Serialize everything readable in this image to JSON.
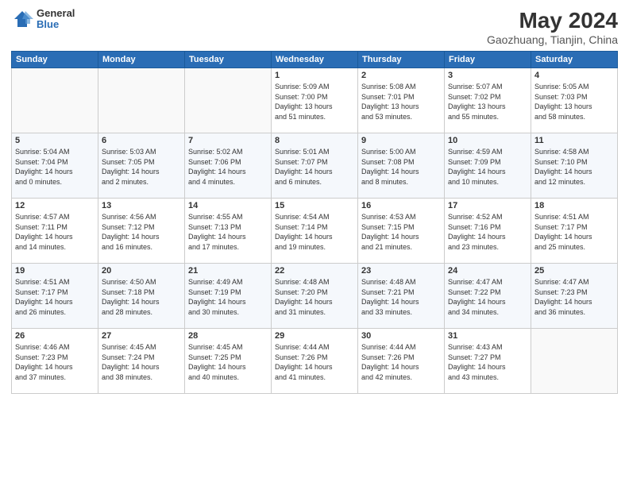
{
  "logo": {
    "general": "General",
    "blue": "Blue"
  },
  "header": {
    "title": "May 2024",
    "subtitle": "Gaozhuang, Tianjin, China"
  },
  "weekdays": [
    "Sunday",
    "Monday",
    "Tuesday",
    "Wednesday",
    "Thursday",
    "Friday",
    "Saturday"
  ],
  "weeks": [
    [
      {
        "day": "",
        "info": ""
      },
      {
        "day": "",
        "info": ""
      },
      {
        "day": "",
        "info": ""
      },
      {
        "day": "1",
        "info": "Sunrise: 5:09 AM\nSunset: 7:00 PM\nDaylight: 13 hours\nand 51 minutes."
      },
      {
        "day": "2",
        "info": "Sunrise: 5:08 AM\nSunset: 7:01 PM\nDaylight: 13 hours\nand 53 minutes."
      },
      {
        "day": "3",
        "info": "Sunrise: 5:07 AM\nSunset: 7:02 PM\nDaylight: 13 hours\nand 55 minutes."
      },
      {
        "day": "4",
        "info": "Sunrise: 5:05 AM\nSunset: 7:03 PM\nDaylight: 13 hours\nand 58 minutes."
      }
    ],
    [
      {
        "day": "5",
        "info": "Sunrise: 5:04 AM\nSunset: 7:04 PM\nDaylight: 14 hours\nand 0 minutes."
      },
      {
        "day": "6",
        "info": "Sunrise: 5:03 AM\nSunset: 7:05 PM\nDaylight: 14 hours\nand 2 minutes."
      },
      {
        "day": "7",
        "info": "Sunrise: 5:02 AM\nSunset: 7:06 PM\nDaylight: 14 hours\nand 4 minutes."
      },
      {
        "day": "8",
        "info": "Sunrise: 5:01 AM\nSunset: 7:07 PM\nDaylight: 14 hours\nand 6 minutes."
      },
      {
        "day": "9",
        "info": "Sunrise: 5:00 AM\nSunset: 7:08 PM\nDaylight: 14 hours\nand 8 minutes."
      },
      {
        "day": "10",
        "info": "Sunrise: 4:59 AM\nSunset: 7:09 PM\nDaylight: 14 hours\nand 10 minutes."
      },
      {
        "day": "11",
        "info": "Sunrise: 4:58 AM\nSunset: 7:10 PM\nDaylight: 14 hours\nand 12 minutes."
      }
    ],
    [
      {
        "day": "12",
        "info": "Sunrise: 4:57 AM\nSunset: 7:11 PM\nDaylight: 14 hours\nand 14 minutes."
      },
      {
        "day": "13",
        "info": "Sunrise: 4:56 AM\nSunset: 7:12 PM\nDaylight: 14 hours\nand 16 minutes."
      },
      {
        "day": "14",
        "info": "Sunrise: 4:55 AM\nSunset: 7:13 PM\nDaylight: 14 hours\nand 17 minutes."
      },
      {
        "day": "15",
        "info": "Sunrise: 4:54 AM\nSunset: 7:14 PM\nDaylight: 14 hours\nand 19 minutes."
      },
      {
        "day": "16",
        "info": "Sunrise: 4:53 AM\nSunset: 7:15 PM\nDaylight: 14 hours\nand 21 minutes."
      },
      {
        "day": "17",
        "info": "Sunrise: 4:52 AM\nSunset: 7:16 PM\nDaylight: 14 hours\nand 23 minutes."
      },
      {
        "day": "18",
        "info": "Sunrise: 4:51 AM\nSunset: 7:17 PM\nDaylight: 14 hours\nand 25 minutes."
      }
    ],
    [
      {
        "day": "19",
        "info": "Sunrise: 4:51 AM\nSunset: 7:17 PM\nDaylight: 14 hours\nand 26 minutes."
      },
      {
        "day": "20",
        "info": "Sunrise: 4:50 AM\nSunset: 7:18 PM\nDaylight: 14 hours\nand 28 minutes."
      },
      {
        "day": "21",
        "info": "Sunrise: 4:49 AM\nSunset: 7:19 PM\nDaylight: 14 hours\nand 30 minutes."
      },
      {
        "day": "22",
        "info": "Sunrise: 4:48 AM\nSunset: 7:20 PM\nDaylight: 14 hours\nand 31 minutes."
      },
      {
        "day": "23",
        "info": "Sunrise: 4:48 AM\nSunset: 7:21 PM\nDaylight: 14 hours\nand 33 minutes."
      },
      {
        "day": "24",
        "info": "Sunrise: 4:47 AM\nSunset: 7:22 PM\nDaylight: 14 hours\nand 34 minutes."
      },
      {
        "day": "25",
        "info": "Sunrise: 4:47 AM\nSunset: 7:23 PM\nDaylight: 14 hours\nand 36 minutes."
      }
    ],
    [
      {
        "day": "26",
        "info": "Sunrise: 4:46 AM\nSunset: 7:23 PM\nDaylight: 14 hours\nand 37 minutes."
      },
      {
        "day": "27",
        "info": "Sunrise: 4:45 AM\nSunset: 7:24 PM\nDaylight: 14 hours\nand 38 minutes."
      },
      {
        "day": "28",
        "info": "Sunrise: 4:45 AM\nSunset: 7:25 PM\nDaylight: 14 hours\nand 40 minutes."
      },
      {
        "day": "29",
        "info": "Sunrise: 4:44 AM\nSunset: 7:26 PM\nDaylight: 14 hours\nand 41 minutes."
      },
      {
        "day": "30",
        "info": "Sunrise: 4:44 AM\nSunset: 7:26 PM\nDaylight: 14 hours\nand 42 minutes."
      },
      {
        "day": "31",
        "info": "Sunrise: 4:43 AM\nSunset: 7:27 PM\nDaylight: 14 hours\nand 43 minutes."
      },
      {
        "day": "",
        "info": ""
      }
    ]
  ]
}
